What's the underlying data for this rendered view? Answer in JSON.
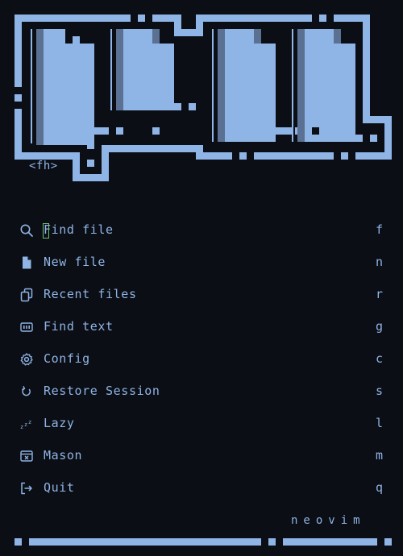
{
  "header": {
    "keymap_label": "<fh>"
  },
  "menu": {
    "items": [
      {
        "label": "Find file",
        "key": "f",
        "icon": "search-icon"
      },
      {
        "label": "New file",
        "key": "n",
        "icon": "new-file-icon"
      },
      {
        "label": "Recent files",
        "key": "r",
        "icon": "recent-files-icon"
      },
      {
        "label": "Find text",
        "key": "g",
        "icon": "find-text-icon"
      },
      {
        "label": "Config",
        "key": "c",
        "icon": "gear-icon"
      },
      {
        "label": "Restore Session",
        "key": "s",
        "icon": "restore-icon"
      },
      {
        "label": "Lazy",
        "key": "l",
        "icon": "sleep-icon"
      },
      {
        "label": "Mason",
        "key": "m",
        "icon": "package-icon"
      },
      {
        "label": "Quit",
        "key": "q",
        "icon": "exit-icon"
      }
    ]
  },
  "footer": {
    "text": "neovim"
  },
  "colors": {
    "background": "#0b0e14",
    "accent": "#8fb4e6",
    "accent_dark": "#5a7193",
    "cursor": "#6fbf73"
  }
}
